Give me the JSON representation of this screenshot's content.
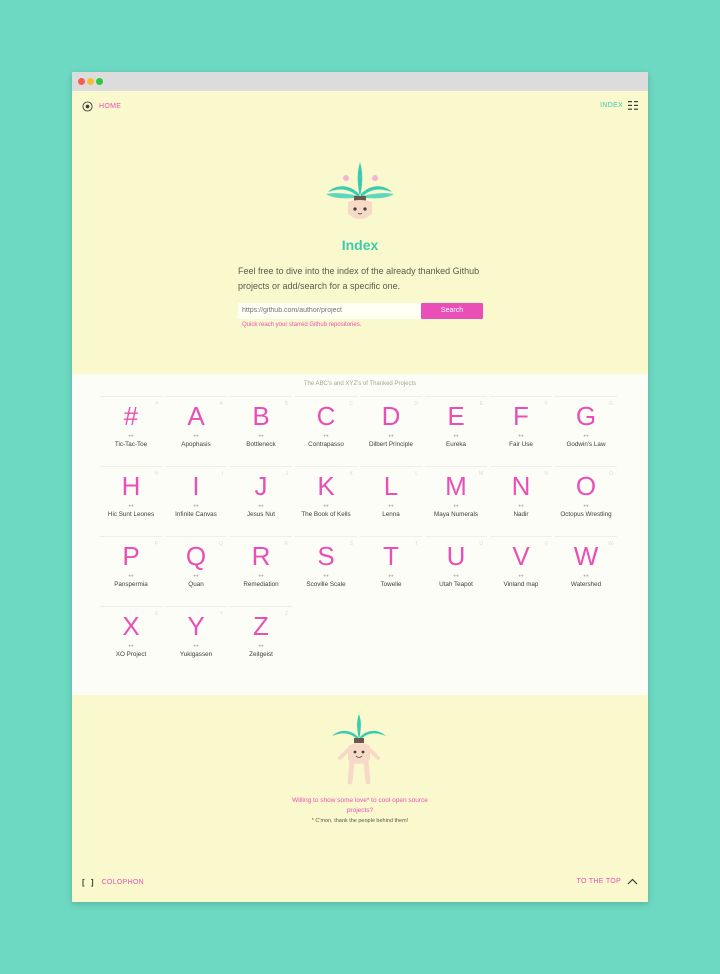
{
  "nav": {
    "home_label": "HOME",
    "index_label": "INDEX"
  },
  "hero": {
    "title": "Index",
    "description": "Feel free to dive into the index of the already thanked Github projects or add/search for a specific one.",
    "search_placeholder": "https://github.com/author/project",
    "search_button": "Search",
    "quick_link": "Quick reach your starred Github repositories."
  },
  "index": {
    "caption": "The ABC's and XYZ's of Thanked Projects",
    "entries": [
      {
        "letter": "#",
        "name": "Tic-Tac-Toe"
      },
      {
        "letter": "A",
        "name": "Apophasis"
      },
      {
        "letter": "B",
        "name": "Bottleneck"
      },
      {
        "letter": "C",
        "name": "Contrapasso"
      },
      {
        "letter": "D",
        "name": "Dilbert Principle"
      },
      {
        "letter": "E",
        "name": "Eureka"
      },
      {
        "letter": "F",
        "name": "Fair Use"
      },
      {
        "letter": "G",
        "name": "Godwin's Law"
      },
      {
        "letter": "H",
        "name": "Hic Sunt Leones"
      },
      {
        "letter": "I",
        "name": "Infinite Canvas"
      },
      {
        "letter": "J",
        "name": "Jesus Nut"
      },
      {
        "letter": "K",
        "name": "The Book of Kells"
      },
      {
        "letter": "L",
        "name": "Lenna"
      },
      {
        "letter": "M",
        "name": "Maya Numerals"
      },
      {
        "letter": "N",
        "name": "Nadir"
      },
      {
        "letter": "O",
        "name": "Octopus Wrestling"
      },
      {
        "letter": "P",
        "name": "Panspermia"
      },
      {
        "letter": "Q",
        "name": "Quan"
      },
      {
        "letter": "R",
        "name": "Remediation"
      },
      {
        "letter": "S",
        "name": "Scoville Scale"
      },
      {
        "letter": "T",
        "name": "Towelie"
      },
      {
        "letter": "U",
        "name": "Utah Teapot"
      },
      {
        "letter": "V",
        "name": "Vinland map"
      },
      {
        "letter": "W",
        "name": "Watershed"
      },
      {
        "letter": "X",
        "name": "XO Project"
      },
      {
        "letter": "Y",
        "name": "Yukigassen"
      },
      {
        "letter": "Z",
        "name": "Zeitgeist"
      }
    ]
  },
  "footer": {
    "cta": "Willing to show some love* to cool open source projects?",
    "note": "* C'mon, thank the people behind them!",
    "colophon_brackets": "[ ]",
    "colophon_label": "COLOPHON",
    "to_top_label": "TO THE TOP"
  },
  "colors": {
    "accent_pink": "#ea4fb7",
    "accent_teal": "#3ccab0",
    "background": "#6dd9c2",
    "page": "#faf9cd"
  }
}
